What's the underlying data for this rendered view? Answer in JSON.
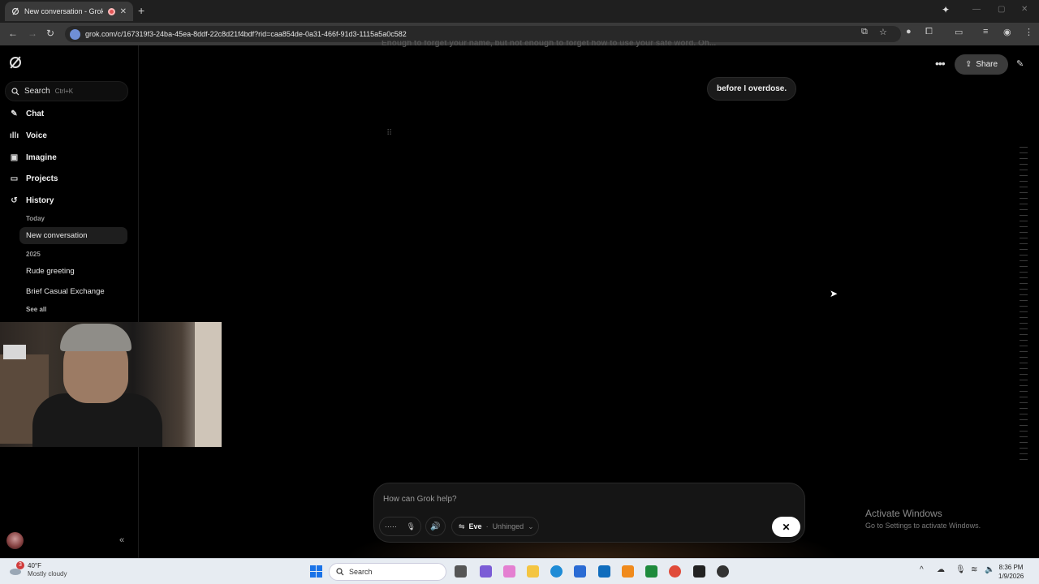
{
  "browser": {
    "tab_title": "New conversation - Grok",
    "url": "grok.com/c/167319f3-24ba-45ea-8ddf-22c8d21f4bdf?rid=caa854de-0a31-466f-91d3-1115a5a0c582"
  },
  "sidebar": {
    "search_label": "Search",
    "search_shortcut": "Ctrl+K",
    "nav": [
      {
        "label": "Chat",
        "icon": "chat-edit-icon"
      },
      {
        "label": "Voice",
        "icon": "waveform-icon"
      },
      {
        "label": "Imagine",
        "icon": "image-icon"
      },
      {
        "label": "Projects",
        "icon": "folder-icon"
      },
      {
        "label": "History",
        "icon": "history-icon"
      }
    ],
    "history": {
      "today_label": "Today",
      "today_items": [
        "New conversation"
      ],
      "year_label": "2025",
      "year_items": [
        "Rude greeting",
        "Brief Casual Exchange"
      ],
      "see_all": "See all"
    }
  },
  "header": {
    "share_label": "Share"
  },
  "conversation": {
    "faded_text": "Enough to forget your name, but not enough to forget how to use your safe word. Oh...",
    "user_message": "before I overdose."
  },
  "composer": {
    "placeholder": "How can Grok help?",
    "persona_name": "Eve",
    "persona_separator": "·",
    "persona_mode": "Unhinged"
  },
  "watermark": {
    "title": "Activate Windows",
    "subtitle": "Go to Settings to activate Windows."
  },
  "taskbar": {
    "weather_temp": "40°F",
    "weather_cond": "Mostly cloudy",
    "weather_badge": "3",
    "search_label": "Search",
    "time": "8:36 PM",
    "date": "1/9/2026"
  }
}
